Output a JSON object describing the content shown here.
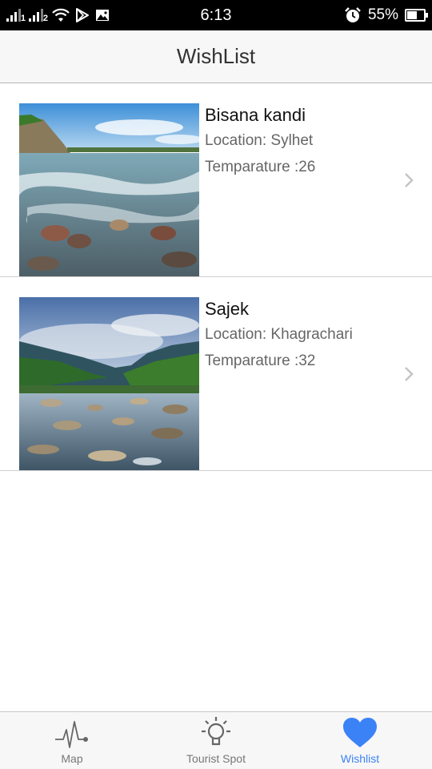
{
  "status_bar": {
    "sim1": "1",
    "sim2": "2",
    "time": "6:13",
    "battery": "55%",
    "battery_level": 0.55,
    "icons": [
      "signal-icon",
      "signal-icon",
      "wifi-icon",
      "play-store-icon",
      "image-icon",
      "alarm-icon",
      "battery-icon"
    ]
  },
  "header": {
    "title": "WishList"
  },
  "wishlist": {
    "items": [
      {
        "name": "Bisana kandi",
        "location": "Location: Sylhet",
        "temperature": "Temparature :26"
      },
      {
        "name": "Sajek",
        "location": "Location: Khagrachari",
        "temperature": "Temparature :32"
      }
    ]
  },
  "tabbar": {
    "tabs": [
      {
        "label": "Map",
        "icon": "pulse-icon",
        "active": false
      },
      {
        "label": "Tourist Spot",
        "icon": "lightbulb-icon",
        "active": false
      },
      {
        "label": "Wishlist",
        "icon": "heart-icon",
        "active": true
      }
    ]
  },
  "colors": {
    "accent": "#3b82f6",
    "header_bg": "#f7f7f7",
    "status_bar": "#000000"
  }
}
